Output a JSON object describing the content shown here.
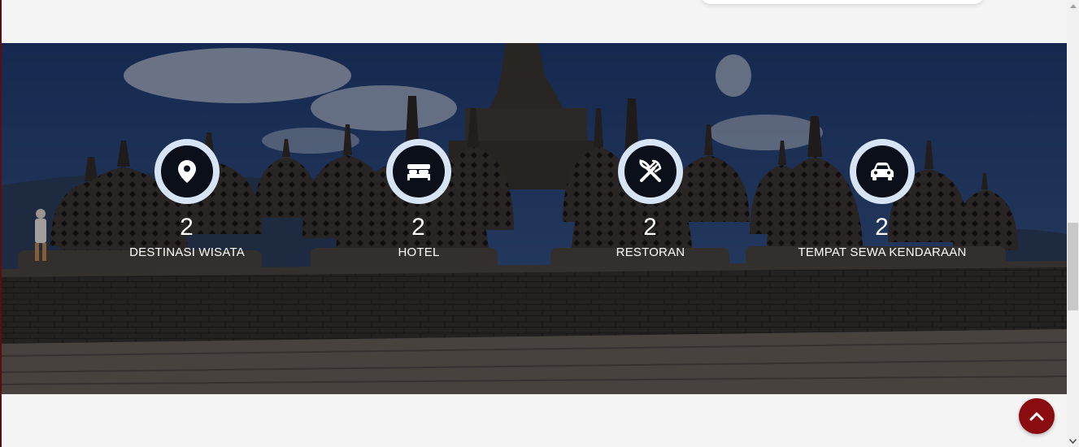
{
  "colors": {
    "accent": "#8b0c10",
    "icon_ring": "#d6e4f6",
    "page_background": "#f4f4f4"
  },
  "stats": [
    {
      "icon": "map-pin-icon",
      "count": "2",
      "label": "DESTINASI WISATA"
    },
    {
      "icon": "bed-icon",
      "count": "2",
      "label": "HOTEL"
    },
    {
      "icon": "fork-knife-icon",
      "count": "2",
      "label": "RESTORAN"
    },
    {
      "icon": "car-icon",
      "count": "2",
      "label": "TEMPAT SEWA KENDARAAN"
    }
  ],
  "back_to_top": {
    "icon": "chevron-up-icon"
  }
}
